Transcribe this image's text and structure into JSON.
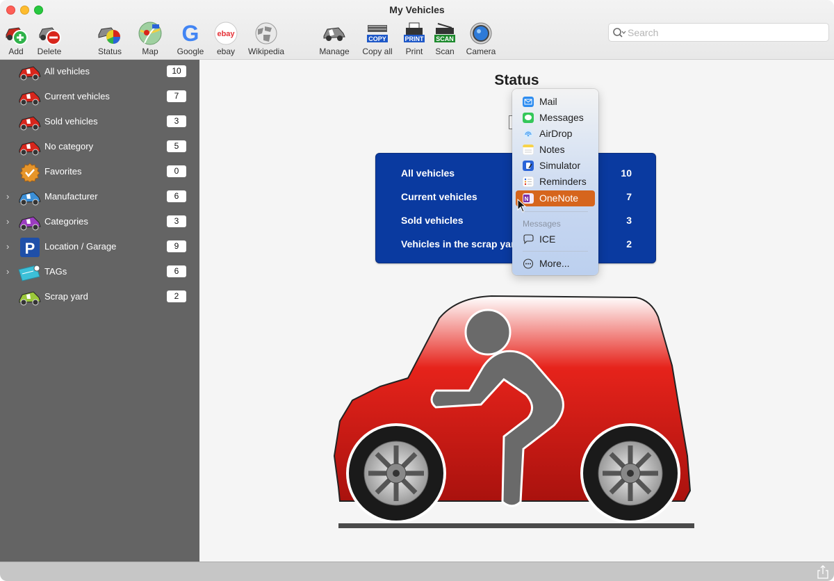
{
  "window": {
    "title": "My Vehicles"
  },
  "toolbar": {
    "add": "Add",
    "delete": "Delete",
    "status": "Status",
    "map": "Map",
    "google": "Google",
    "ebay": "ebay",
    "wikipedia": "Wikipedia",
    "manage": "Manage",
    "copy_all": "Copy all",
    "print": "Print",
    "scan": "Scan",
    "camera": "Camera",
    "copy_badge": "COPY",
    "print_badge": "PRINT",
    "scan_badge": "SCAN",
    "google_glyph": "G",
    "ebay_glyph": "ebay"
  },
  "search": {
    "placeholder": "Search",
    "value": ""
  },
  "sidebar": {
    "items": [
      {
        "label": "All vehicles",
        "count": "10",
        "icon": "car-icon",
        "expandable": false
      },
      {
        "label": "Current vehicles",
        "count": "7",
        "icon": "car-icon",
        "expandable": false
      },
      {
        "label": "Sold vehicles",
        "count": "3",
        "icon": "car-icon",
        "expandable": false
      },
      {
        "label": "No category",
        "count": "5",
        "icon": "car-icon",
        "expandable": false
      },
      {
        "label": "Favorites",
        "count": "0",
        "icon": "badge-icon",
        "expandable": false
      },
      {
        "label": "Manufacturer",
        "count": "6",
        "icon": "car-icon",
        "expandable": true
      },
      {
        "label": "Categories",
        "count": "3",
        "icon": "car-icon",
        "expandable": true
      },
      {
        "label": "Location / Garage",
        "count": "9",
        "icon": "parking-icon",
        "expandable": true
      },
      {
        "label": "TAGs",
        "count": "6",
        "icon": "tag-icon",
        "expandable": true
      },
      {
        "label": "Scrap yard",
        "count": "2",
        "icon": "car-icon",
        "expandable": false
      }
    ],
    "parking_glyph": "P"
  },
  "main": {
    "title": "Status",
    "summary": [
      {
        "label": "All vehicles",
        "value": "10"
      },
      {
        "label": "Current vehicles",
        "value": "7"
      },
      {
        "label": "Sold vehicles",
        "value": "3"
      },
      {
        "label": "Vehicles in the scrap yard",
        "value": "2"
      }
    ]
  },
  "share_menu": {
    "items": [
      {
        "label": "Mail",
        "icon": "mail-icon",
        "color": "#2d8cf0"
      },
      {
        "label": "Messages",
        "icon": "messages-icon",
        "color": "#34c759"
      },
      {
        "label": "AirDrop",
        "icon": "airdrop-icon",
        "color": "#5aa9f5"
      },
      {
        "label": "Notes",
        "icon": "notes-icon",
        "color": "#f7d34a"
      },
      {
        "label": "Simulator",
        "icon": "simulator-icon",
        "color": "#2a64d8"
      },
      {
        "label": "Reminders",
        "icon": "reminders-icon",
        "color": "#ffffff"
      },
      {
        "label": "OneNote",
        "icon": "onenote-icon",
        "color": "#7b2fa6",
        "selected": true
      }
    ],
    "section_header": "Messages",
    "contact": {
      "label": "ICE",
      "icon": "chat-bubble-icon"
    },
    "more": {
      "label": "More...",
      "icon": "ellipsis-icon"
    }
  },
  "colors": {
    "sidebar_bg": "#646464",
    "panel_bg": "#0a3aa0",
    "menu_selection": "#d6651d",
    "car_red": "#d31a14"
  }
}
